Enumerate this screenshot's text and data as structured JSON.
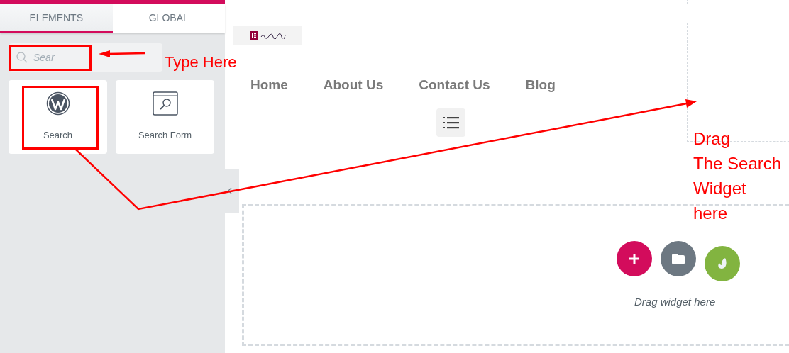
{
  "sidebar": {
    "tabs": [
      {
        "label": "ELEMENTS",
        "selected": true
      },
      {
        "label": "GLOBAL",
        "selected": false
      }
    ],
    "search": {
      "value": "Sear"
    },
    "widgets": [
      {
        "label": "Search",
        "kind": "wordpress"
      },
      {
        "label": "Search Form",
        "kind": "search-form"
      }
    ]
  },
  "canvas": {
    "nav": [
      "Home",
      "About Us",
      "Contact Us",
      "Blog"
    ],
    "drop_zone": {
      "hint": "Drag widget here"
    }
  },
  "annotations": [
    {
      "text": "Type Here"
    },
    {
      "text": "Drag\nThe Search\nWidget\nhere"
    }
  ]
}
